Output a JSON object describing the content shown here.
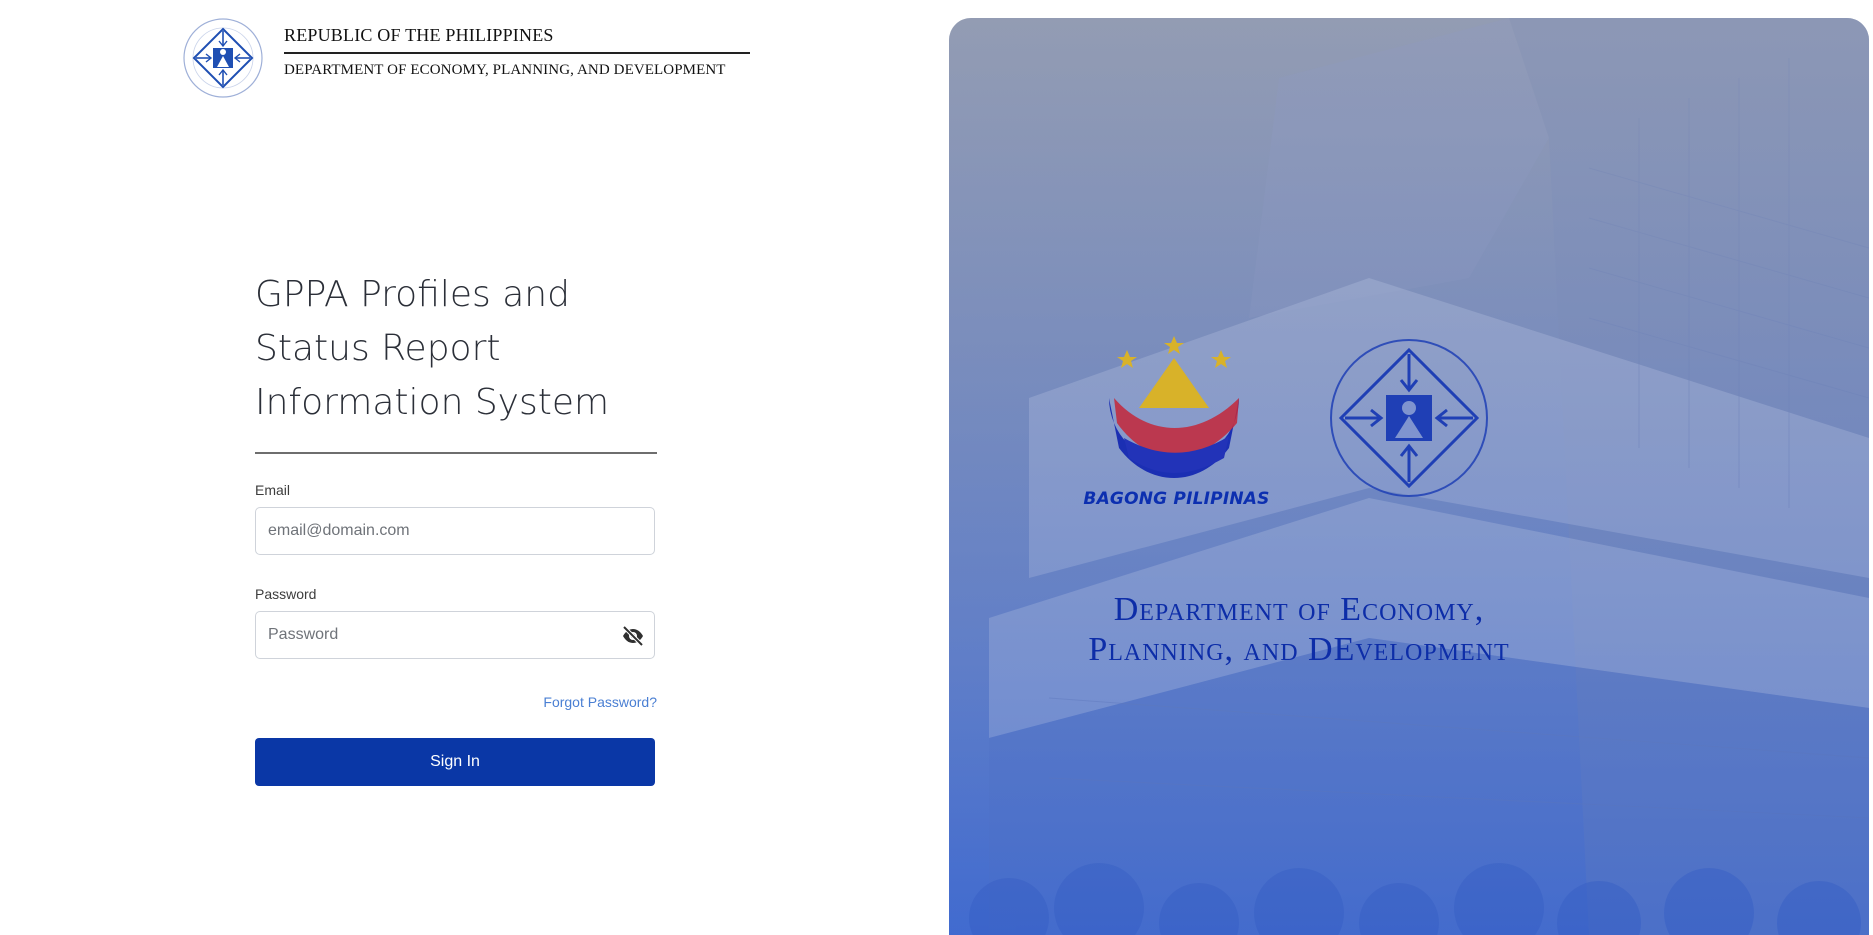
{
  "header": {
    "line1": "REPUBLIC OF THE PHILIPPINES",
    "line2": "DEPARTMENT OF ECONOMY, PLANNING, AND DEVELOPMENT"
  },
  "login": {
    "title": "GPPA Profiles and\nStatus Report\nInformation System",
    "email_label": "Email",
    "email_placeholder": "email@domain.com",
    "email_value": "",
    "password_label": "Password",
    "password_placeholder": "Password",
    "password_value": "",
    "forgot_label": "Forgot Password?",
    "signin_label": "Sign In"
  },
  "hero": {
    "bagong_label": "BAGONG PILIPINAS",
    "dept_title": "Department of Economy,\nPlanning, and DEvelopment"
  },
  "icons": {
    "header_seal": "depdev-seal-icon",
    "password_toggle": "eye-off-icon",
    "bagong_logo": "bagong-pilipinas-logo",
    "hero_seal": "depdev-seal-icon"
  },
  "colors": {
    "primary_button": "#0a37a6",
    "link": "#4a7fd3",
    "brand_blue": "#0d2da8"
  }
}
